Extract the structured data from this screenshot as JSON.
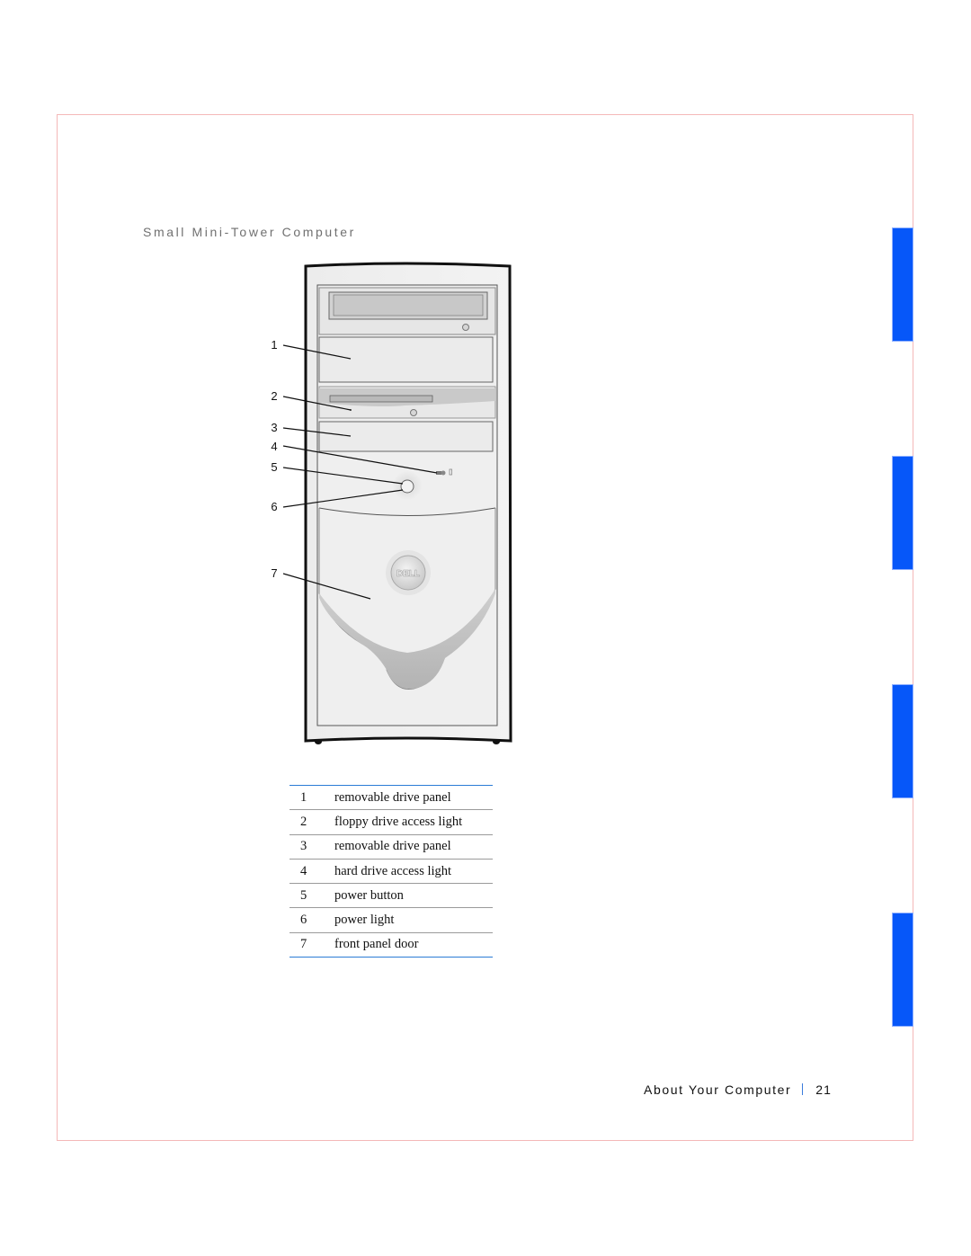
{
  "page": {
    "section_title": "Small Mini-Tower Computer",
    "footer": {
      "chapter_title": "About Your Computer",
      "page_number": "21"
    },
    "colors": {
      "tab_blue": "#0657f9",
      "frame_pink": "#f4b8b8",
      "rule_blue": "#2b7cd6"
    }
  },
  "figure": {
    "name": "small-mini-tower-front-view",
    "logo_text": "DELL",
    "callouts": [
      "1",
      "2",
      "3",
      "4",
      "5",
      "6",
      "7"
    ]
  },
  "legend": {
    "rows": [
      {
        "num": "1",
        "label": "removable drive panel"
      },
      {
        "num": "2",
        "label": "floppy drive access light"
      },
      {
        "num": "3",
        "label": "removable drive panel"
      },
      {
        "num": "4",
        "label": "hard drive access light"
      },
      {
        "num": "5",
        "label": "power button"
      },
      {
        "num": "6",
        "label": "power light"
      },
      {
        "num": "7",
        "label": "front panel door"
      }
    ]
  }
}
